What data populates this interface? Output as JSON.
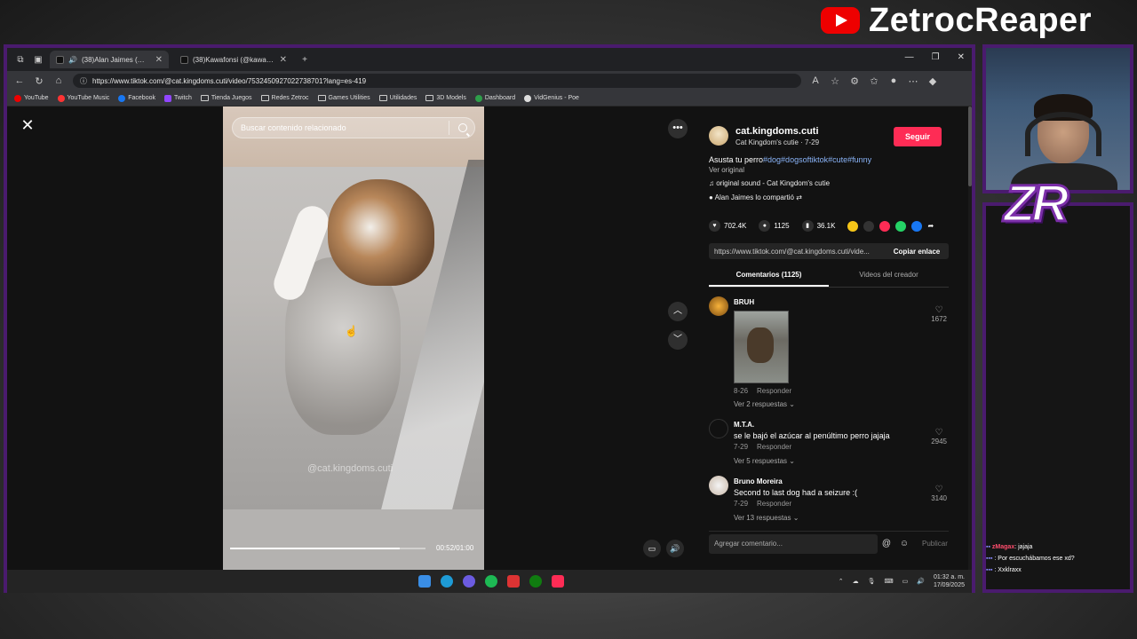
{
  "brand": {
    "name": "ZetrocReaper"
  },
  "browser": {
    "tabs": [
      {
        "title": "(38)Alan Jaimes (@alan.jaimes",
        "active": true
      },
      {
        "title": "(38)Kawafonsi (@kawafonsii) | Tik",
        "active": false
      }
    ],
    "url": "https://www.tiktok.com/@cat.kingdoms.cuti/video/7532450927022738701?lang=es-419",
    "bookmarks": [
      "YouTube",
      "YouTube Music",
      "Facebook",
      "Twitch",
      "Tienda Juegos",
      "Redes Zetroc",
      "Games Utilities",
      "Utilidades",
      "3D Models",
      "Dashboard",
      "VidGenius - Poe"
    ]
  },
  "video": {
    "search_placeholder": "Buscar contenido relacionado",
    "watermark": "@cat.kingdoms.cuti",
    "timecode": "00:52/01:00",
    "progress": 0.87
  },
  "post": {
    "username": "cat.kingdoms.cuti",
    "subline": "Cat Kingdom's cutie · 7-29",
    "follow_label": "Seguir",
    "description": "Asusta tu perro",
    "tags": "#dog#dogsoftiktok#cute#funny",
    "see_original": "Ver original",
    "sound": "original sound - Cat Kingdom's cutie",
    "shared_by": "Alan Jaimes lo compartió",
    "likes": "702.4K",
    "comments": "1125",
    "saves": "36.1K",
    "link": "https://www.tiktok.com/@cat.kingdoms.cuti/vide...",
    "copy_label": "Copiar enlace",
    "tab_comments": "Comentarios (1125)",
    "tab_creator": "Videos del creador"
  },
  "comments": [
    {
      "name": "BRUH",
      "text": "",
      "date": "8-26",
      "reply": "Responder",
      "replies": "Ver 2 respuestas",
      "likes": "1672"
    },
    {
      "name": "M.T.A.",
      "text": "se le bajó el azúcar al penúltimo perro jajaja",
      "date": "7-29",
      "reply": "Responder",
      "replies": "Ver 5 respuestas",
      "likes": "2945"
    },
    {
      "name": "Bruno Moreira",
      "text": "Second to last dog had a seizure :(",
      "date": "7-29",
      "reply": "Responder",
      "replies": "Ver 13 respuestas",
      "likes": "3140"
    }
  ],
  "composer": {
    "placeholder": "Agregar comentario...",
    "publish": "Publicar"
  },
  "taskbar": {
    "time": "01:32 a. m.",
    "date": "17/09/2025"
  },
  "chat": [
    {
      "user": "zMagax",
      "msg": ": jajaja"
    },
    {
      "user": "",
      "msg": ": Por escuchábamos ese xd?"
    },
    {
      "user": "",
      "msg": ": Xxklraxx"
    }
  ],
  "logo_text": "ZR"
}
